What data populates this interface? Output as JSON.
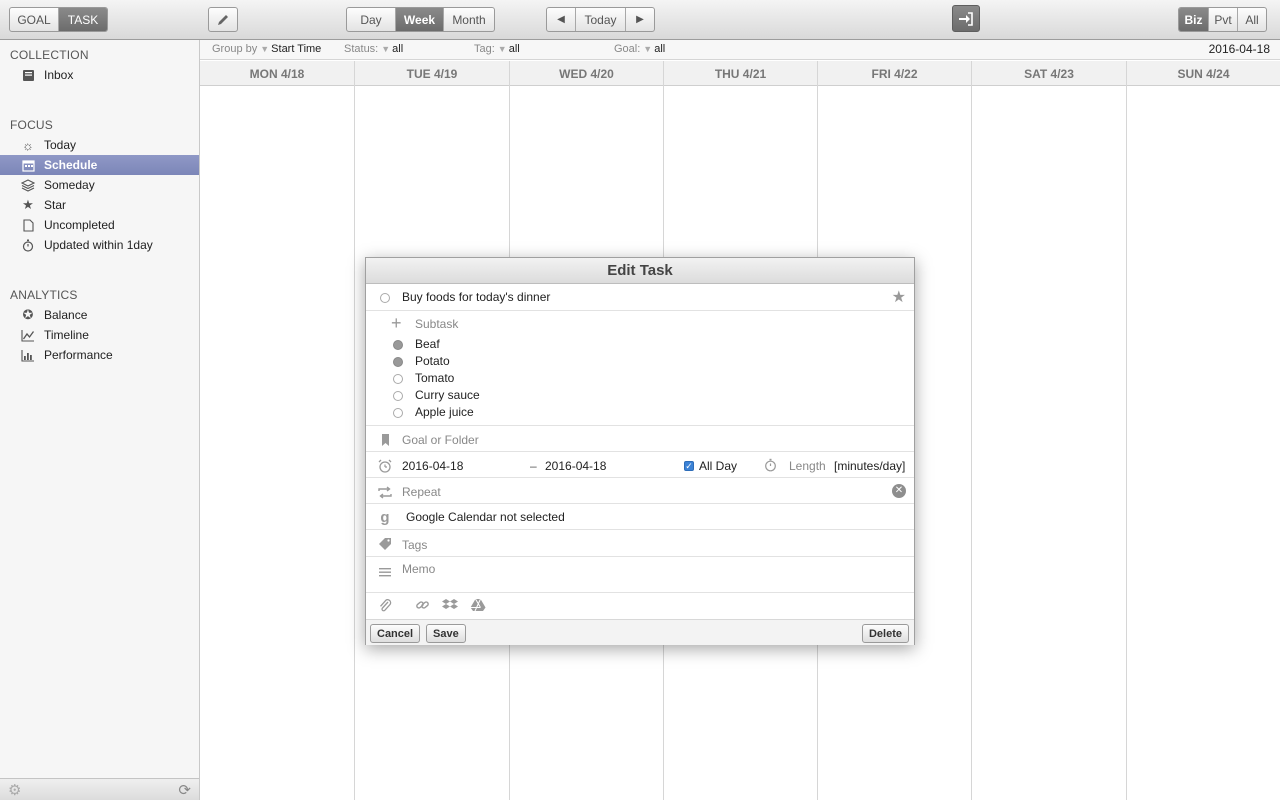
{
  "toolbar": {
    "mode_tabs": [
      "GOAL",
      "TASK"
    ],
    "view_tabs": [
      "Day",
      "Week",
      "Month"
    ],
    "today_label": "Today",
    "scope_tabs": [
      "Biz",
      "Pvt",
      "All"
    ]
  },
  "sidebar": {
    "collection_title": "COLLECTION",
    "collection_items": [
      "Inbox"
    ],
    "focus_title": "FOCUS",
    "focus_items": [
      "Today",
      "Schedule",
      "Someday",
      "Star",
      "Uncompleted",
      "Updated within 1day"
    ],
    "selected": "Schedule",
    "analytics_title": "ANALYTICS",
    "analytics_items": [
      "Balance",
      "Timeline",
      "Performance"
    ]
  },
  "filters": {
    "group_label": "Group by",
    "group_value": "Start Time",
    "status_label": "Status:",
    "status_value": "all",
    "tag_label": "Tag:",
    "tag_value": "all",
    "goal_label": "Goal:",
    "goal_value": "all",
    "date": "2016-04-18"
  },
  "calendar": {
    "days": [
      "MON 4/18",
      "TUE 4/19",
      "WED 4/20",
      "THU 4/21",
      "FRI 4/22",
      "SAT 4/23",
      "SUN 4/24"
    ]
  },
  "dialog": {
    "title": "Edit Task",
    "task_name": "Buy foods for today's dinner",
    "subtask_placeholder": "Subtask",
    "subtasks": [
      {
        "name": "Beaf",
        "done": true
      },
      {
        "name": "Potato",
        "done": true
      },
      {
        "name": "Tomato",
        "done": false
      },
      {
        "name": "Curry sauce",
        "done": false
      },
      {
        "name": "Apple juice",
        "done": false
      }
    ],
    "goal_placeholder": "Goal or Folder",
    "start_date": "2016-04-18",
    "date_separator": "–",
    "end_date": "2016-04-18",
    "all_day_label": "All Day",
    "length_label": "Length",
    "length_value": "[minutes/day]",
    "repeat_placeholder": "Repeat",
    "gcal_text": "Google Calendar not selected",
    "tags_placeholder": "Tags",
    "memo_placeholder": "Memo",
    "cancel_label": "Cancel",
    "save_label": "Save",
    "delete_label": "Delete"
  }
}
